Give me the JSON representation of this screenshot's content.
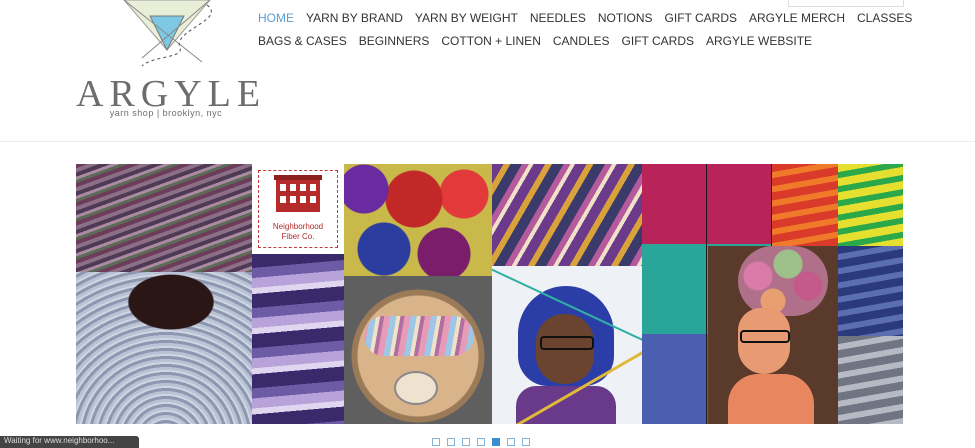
{
  "logo": {
    "word": "ARGYLE",
    "tagline": "yarn shop | brooklyn, nyc"
  },
  "search": {
    "placeholder": ""
  },
  "nav": {
    "row1": [
      "HOME",
      "YARN BY BRAND",
      "YARN BY WEIGHT",
      "NEEDLES",
      "NOTIONS",
      "GIFT CARDS",
      "ARGYLE MERCH",
      "CLASSES"
    ],
    "row2": [
      "BAGS & CASES",
      "BEGINNERS",
      "COTTON + LINEN",
      "CANDLES",
      "GIFT CARDS",
      "ARGYLE WEBSITE"
    ],
    "active": "HOME"
  },
  "collage": {
    "neighborhood_label_1": "Neighborhood",
    "neighborhood_label_2": "Fiber Co."
  },
  "slideshow": {
    "dot_count": 7,
    "active_index": 4
  },
  "statusbar": {
    "text": "Waiting for www.neighborhoo..."
  },
  "colors": {
    "accent": "#5b9bd5",
    "logo_gray": "#6d6d6d",
    "logo_blue": "#7ec8e3",
    "logo_cream": "#e9eed6"
  }
}
